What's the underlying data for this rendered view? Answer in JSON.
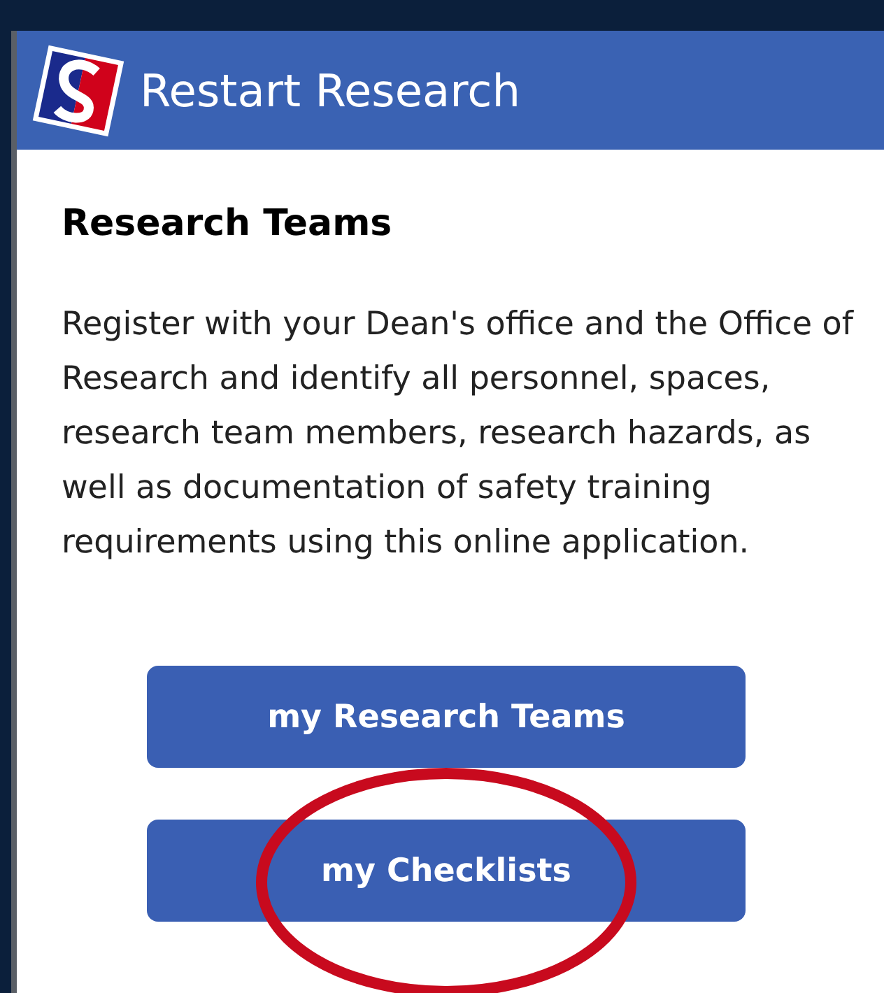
{
  "header": {
    "title": "Restart Research"
  },
  "section": {
    "heading": "Research Teams",
    "description": "Register with your Dean's office and the Office of Research and identify all personnel, spaces, research team members, research hazards, as well as documentation of safety training requirements using this online application."
  },
  "buttons": [
    {
      "label": "my Research Teams",
      "highlighted": false
    },
    {
      "label": "my Checklists",
      "highlighted": true
    }
  ]
}
